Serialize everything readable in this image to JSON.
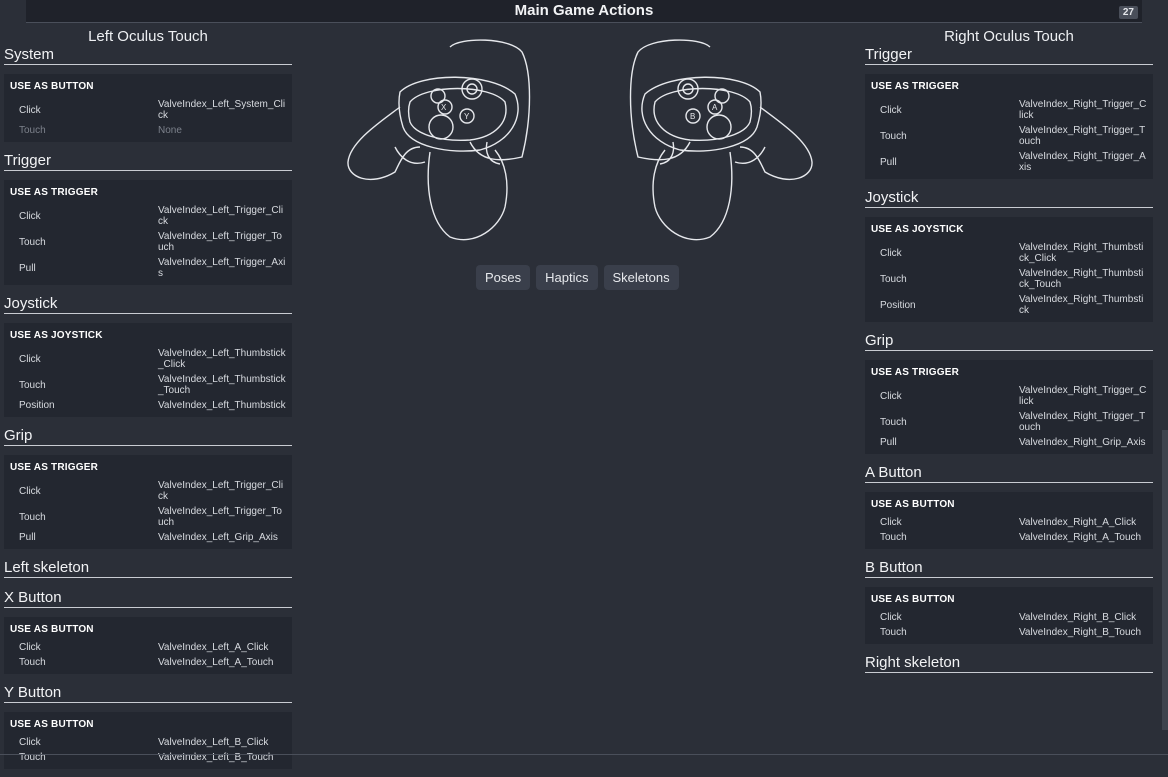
{
  "header": {
    "title": "Main Game Actions",
    "badge": "27"
  },
  "left": {
    "title": "Left Oculus Touch",
    "sections": [
      {
        "name": "System",
        "head": "USE AS BUTTON",
        "rows": [
          {
            "k": "Click",
            "v": "ValveIndex_Left_System_Click",
            "tall": true
          },
          {
            "k": "Touch",
            "v": "None",
            "dim": true
          }
        ]
      },
      {
        "name": "Trigger",
        "head": "USE AS TRIGGER",
        "rows": [
          {
            "k": "Click",
            "v": "ValveIndex_Left_Trigger_Click",
            "tall": true
          },
          {
            "k": "Touch",
            "v": "ValveIndex_Left_Trigger_Touch",
            "tall": true
          },
          {
            "k": "Pull",
            "v": "ValveIndex_Left_Trigger_Axis",
            "tall": true
          }
        ]
      },
      {
        "name": "Joystick",
        "head": "USE AS JOYSTICK",
        "rows": [
          {
            "k": "Click",
            "v": "ValveIndex_Left_Thumbstick_Click",
            "tall": true
          },
          {
            "k": "Touch",
            "v": "ValveIndex_Left_Thumbstick_Touch",
            "tall": true
          },
          {
            "k": "Position",
            "v": "ValveIndex_Left_Thumbstick"
          }
        ]
      },
      {
        "name": "Grip",
        "head": "USE AS TRIGGER",
        "rows": [
          {
            "k": "Click",
            "v": "ValveIndex_Left_Trigger_Click",
            "tall": true
          },
          {
            "k": "Touch",
            "v": "ValveIndex_Left_Trigger_Touch",
            "tall": true
          },
          {
            "k": "Pull",
            "v": "ValveIndex_Left_Grip_Axis"
          }
        ]
      },
      {
        "name": "Left skeleton"
      },
      {
        "name": "X Button",
        "head": "USE AS BUTTON",
        "rows": [
          {
            "k": "Click",
            "v": "ValveIndex_Left_A_Click"
          },
          {
            "k": "Touch",
            "v": "ValveIndex_Left_A_Touch"
          }
        ]
      },
      {
        "name": "Y Button",
        "head": "USE AS BUTTON",
        "rows": [
          {
            "k": "Click",
            "v": "ValveIndex_Left_B_Click"
          },
          {
            "k": "Touch",
            "v": "ValveIndex_Left_B_Touch"
          }
        ]
      }
    ]
  },
  "right": {
    "title": "Right Oculus Touch",
    "sections": [
      {
        "name": "Trigger",
        "head": "USE AS TRIGGER",
        "rows": [
          {
            "k": "Click",
            "v": "ValveIndex_Right_Trigger_Click",
            "tall": true
          },
          {
            "k": "Touch",
            "v": "ValveIndex_Right_Trigger_Touch",
            "tall": true
          },
          {
            "k": "Pull",
            "v": "ValveIndex_Right_Trigger_Axis",
            "tall": true
          }
        ]
      },
      {
        "name": "Joystick",
        "head": "USE AS JOYSTICK",
        "rows": [
          {
            "k": "Click",
            "v": "ValveIndex_Right_Thumbstick_Click",
            "tall": true
          },
          {
            "k": "Touch",
            "v": "ValveIndex_Right_Thumbstick_Touch",
            "tall": true
          },
          {
            "k": "Position",
            "v": "ValveIndex_Right_Thumbstick",
            "tall": true
          }
        ]
      },
      {
        "name": "Grip",
        "head": "USE AS TRIGGER",
        "rows": [
          {
            "k": "Click",
            "v": "ValveIndex_Right_Trigger_Click",
            "tall": true
          },
          {
            "k": "Touch",
            "v": "ValveIndex_Right_Trigger_Touch",
            "tall": true
          },
          {
            "k": "Pull",
            "v": "ValveIndex_Right_Grip_Axis"
          }
        ]
      },
      {
        "name": "A Button",
        "head": "USE AS BUTTON",
        "rows": [
          {
            "k": "Click",
            "v": "ValveIndex_Right_A_Click"
          },
          {
            "k": "Touch",
            "v": "ValveIndex_Right_A_Touch"
          }
        ]
      },
      {
        "name": "B Button",
        "head": "USE AS BUTTON",
        "rows": [
          {
            "k": "Click",
            "v": "ValveIndex_Right_B_Click"
          },
          {
            "k": "Touch",
            "v": "ValveIndex_Right_B_Touch"
          }
        ]
      },
      {
        "name": "Right skeleton"
      }
    ]
  },
  "controllers": {
    "left_buttons": [
      "X",
      "Y"
    ],
    "right_buttons": [
      "A",
      "B"
    ]
  },
  "tabs": [
    {
      "label": "Poses"
    },
    {
      "label": "Haptics"
    },
    {
      "label": "Skeletons"
    }
  ],
  "colors": {
    "background": "#2b2f38",
    "panel": "#232730",
    "tab": "#3a3f4b"
  }
}
